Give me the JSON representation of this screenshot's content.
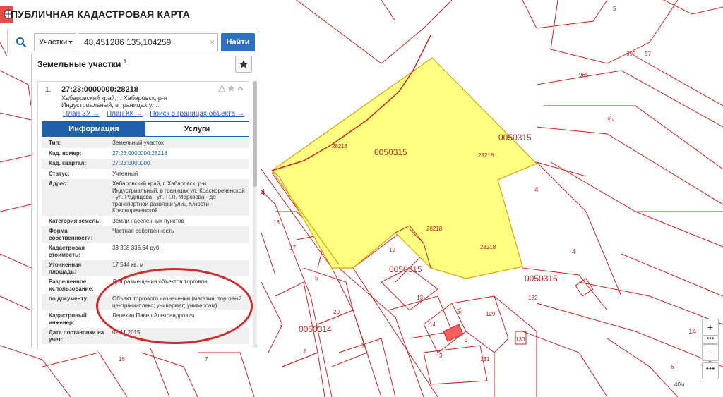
{
  "app": {
    "title": "ПУБЛИЧНАЯ КАДАСТРОВАЯ КАРТА"
  },
  "search": {
    "type_label": "Участки",
    "value": "48,451286 135,104259",
    "clear_glyph": "×",
    "find_label": "Найти"
  },
  "results": {
    "title": "Земельные участки",
    "count": "1",
    "item": {
      "index": "1.",
      "cad_number": "27:23:0000000:28218",
      "address_short": "Хабаровский край, г. Хабаровск, р-н Индустриальный, в границах ул...",
      "links": [
        "План ЗУ →",
        "План КК →",
        "Поиск в границах объекта →"
      ],
      "tabs": [
        "Информация",
        "Услуги"
      ],
      "attributes": [
        {
          "key": "Тип:",
          "value": "Земельный участок",
          "link": false
        },
        {
          "key": "Кад. номер:",
          "value": "27:23:0000000:28218",
          "link": true
        },
        {
          "key": "Кад. квартал:",
          "value": "27:23:0000000",
          "link": true
        },
        {
          "key": "Статус:",
          "value": "Учтенный",
          "link": false
        },
        {
          "key": "Адрес:",
          "value": "Хабаровский край, г. Хабаровск, р-н Индустриальный, в границах ул. Краснореченской - ул. Радищева - ул. П.Л. Морозова - до транспортной развязки улиц Юности - Краснореченской",
          "link": false
        },
        {
          "key": "Категория земель:",
          "value": "Земли населённых пунктов",
          "link": false
        },
        {
          "key": "Форма собственности:",
          "value": "Частная собственность",
          "link": false
        },
        {
          "key": "Кадастровая стоимость:",
          "value": "33 308 336,64 руб.",
          "link": false
        },
        {
          "key": "Уточненная площадь:",
          "value": "17 544 кв. м",
          "link": false
        },
        {
          "key": "Разрешенное использование:",
          "value": "Для размещения объектов торговли",
          "link": false
        },
        {
          "key": "по документу:",
          "value": "Объект торгового назначения (магазин; торговый центр/комплекс; универмаг; универсам)",
          "link": false
        },
        {
          "key": "Кадастровый инженер:",
          "value": "Лепехин Павел Александрович",
          "link": false
        },
        {
          "key": "Дата постановки на учет:",
          "value": "02.11.2015",
          "link": false
        }
      ]
    }
  },
  "map": {
    "labels": [
      "5",
      "692",
      "57",
      "965",
      "37",
      "0050315",
      "28218",
      "0050315",
      "28218",
      "4",
      "4",
      "18",
      "17",
      "12",
      "28218",
      "28218",
      "4",
      "0050315",
      "5",
      "0050315",
      "132",
      "13",
      "14",
      "129",
      "20",
      "0050314",
      "3",
      "14",
      "3",
      "130",
      "8",
      "7",
      "131",
      "14",
      "18",
      "7",
      "3",
      "6"
    ],
    "scale": "40м",
    "colors": {
      "parcel_border": "#d42020",
      "selected_fill": "#ffff80",
      "selected_border": "#e0a000"
    }
  },
  "controls": {
    "zoom_in": "+",
    "zoom_out": "−",
    "dots": "•••",
    "more": "•••"
  }
}
